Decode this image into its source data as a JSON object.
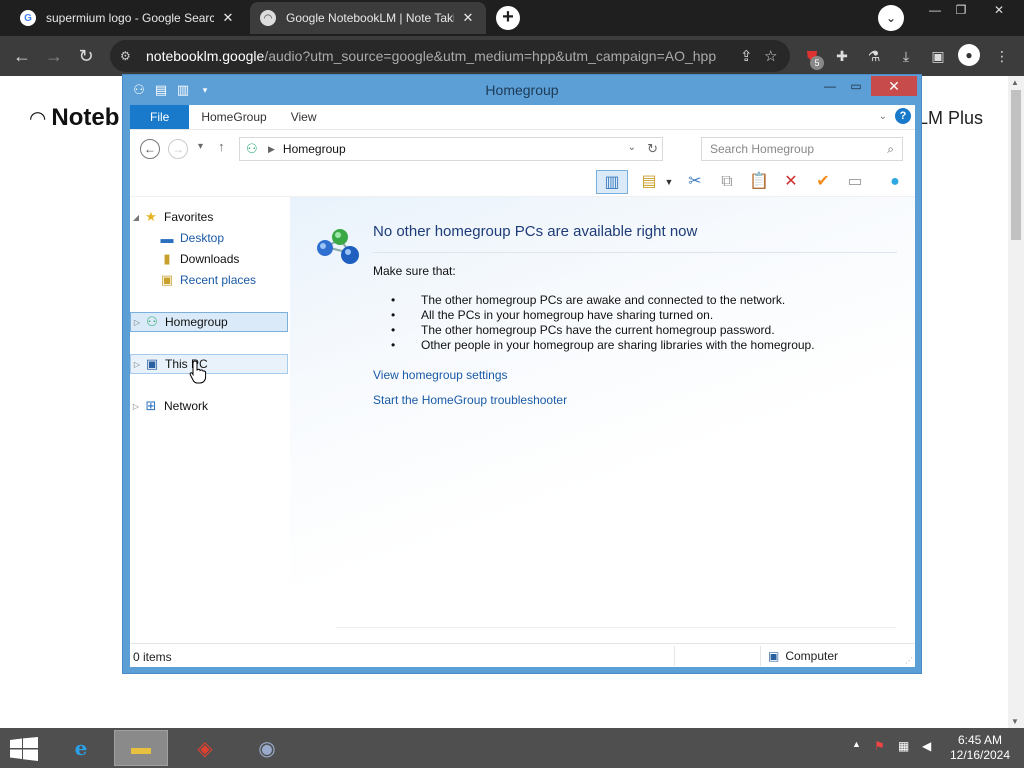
{
  "browser": {
    "tabs": [
      {
        "title": "supermium logo - Google Search",
        "favicon": "google-g-icon",
        "active": false
      },
      {
        "title": "Google NotebookLM | Note Taking",
        "favicon": "notebooklm-icon",
        "active": true
      }
    ],
    "url_host": "notebooklm.google",
    "url_path": "/audio?utm_source=google&utm_medium=hpp&utm_campaign=AO_hpp",
    "extension_badge": "5"
  },
  "page_behind": {
    "logo_text": "Noteb",
    "plus_text": "LM Plus"
  },
  "explorer": {
    "title": "Homegroup",
    "ribbon_tabs": [
      "File",
      "HomeGroup",
      "View"
    ],
    "address_location": "Homegroup",
    "search_placeholder": "Search Homegroup",
    "nav": {
      "favorites": "Favorites",
      "desktop": "Desktop",
      "downloads": "Downloads",
      "recent_places": "Recent places",
      "homegroup": "Homegroup",
      "this_pc": "This PC",
      "network": "Network"
    },
    "content": {
      "heading": "No other homegroup PCs are available right now",
      "make_sure": "Make sure that:",
      "bullets": [
        "The other homegroup PCs are awake and connected to the network.",
        "All the PCs in your homegroup have sharing turned on.",
        "The other homegroup PCs have the current homegroup password.",
        "Other people in your homegroup are sharing libraries with the homegroup."
      ],
      "link_settings": "View homegroup settings",
      "link_troubleshooter": "Start the HomeGroup troubleshooter"
    },
    "status": {
      "items": "0 items",
      "location": "Computer"
    }
  },
  "taskbar": {
    "time": "6:45 AM",
    "date": "12/16/2024"
  },
  "colors": {
    "chrome_dark": "#1f1f1f",
    "explorer_frame": "#5c9fd6",
    "ribbon_file": "#1979ca",
    "link": "#1a5aa6",
    "heading": "#1e3c78",
    "close_red": "#c74b4b",
    "taskbar": "#4f4f4f"
  }
}
